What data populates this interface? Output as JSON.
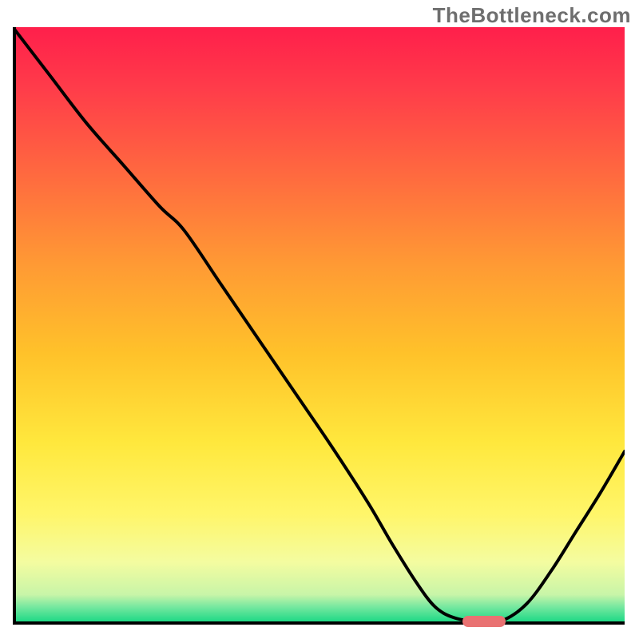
{
  "watermark": "TheBottleneck.com",
  "chart_data": {
    "type": "line",
    "title": "",
    "xlabel": "",
    "ylabel": "",
    "xlim": [
      0,
      100
    ],
    "ylim": [
      0,
      100
    ],
    "gradient_stops": [
      {
        "offset": 0.0,
        "color": "#ff1f4b"
      },
      {
        "offset": 0.1,
        "color": "#ff3b4a"
      },
      {
        "offset": 0.25,
        "color": "#ff6a3f"
      },
      {
        "offset": 0.4,
        "color": "#ff9a34"
      },
      {
        "offset": 0.55,
        "color": "#ffc22a"
      },
      {
        "offset": 0.7,
        "color": "#ffe83d"
      },
      {
        "offset": 0.82,
        "color": "#fff66a"
      },
      {
        "offset": 0.9,
        "color": "#f4fca0"
      },
      {
        "offset": 0.955,
        "color": "#c8f5a8"
      },
      {
        "offset": 0.975,
        "color": "#78e8a0"
      },
      {
        "offset": 1.0,
        "color": "#1fd986"
      }
    ],
    "series": [
      {
        "name": "bottleneck-curve",
        "x": [
          0.0,
          6,
          12,
          18,
          24,
          28,
          34,
          40,
          46,
          52,
          58,
          62,
          66,
          69,
          72,
          76,
          80,
          84,
          88,
          92,
          96,
          100
        ],
        "y": [
          100,
          92,
          84,
          77,
          70,
          66,
          57,
          48,
          39,
          30,
          20.5,
          13.5,
          7,
          3,
          1.2,
          0.5,
          0.7,
          3.5,
          9,
          15.5,
          22,
          29
        ]
      }
    ],
    "flat_minimum": {
      "x_start": 72,
      "x_end": 79,
      "y": 0.5
    },
    "marker": {
      "x_start": 73.5,
      "x_end": 80.5,
      "y": 0.5,
      "color": "#e97272"
    }
  }
}
